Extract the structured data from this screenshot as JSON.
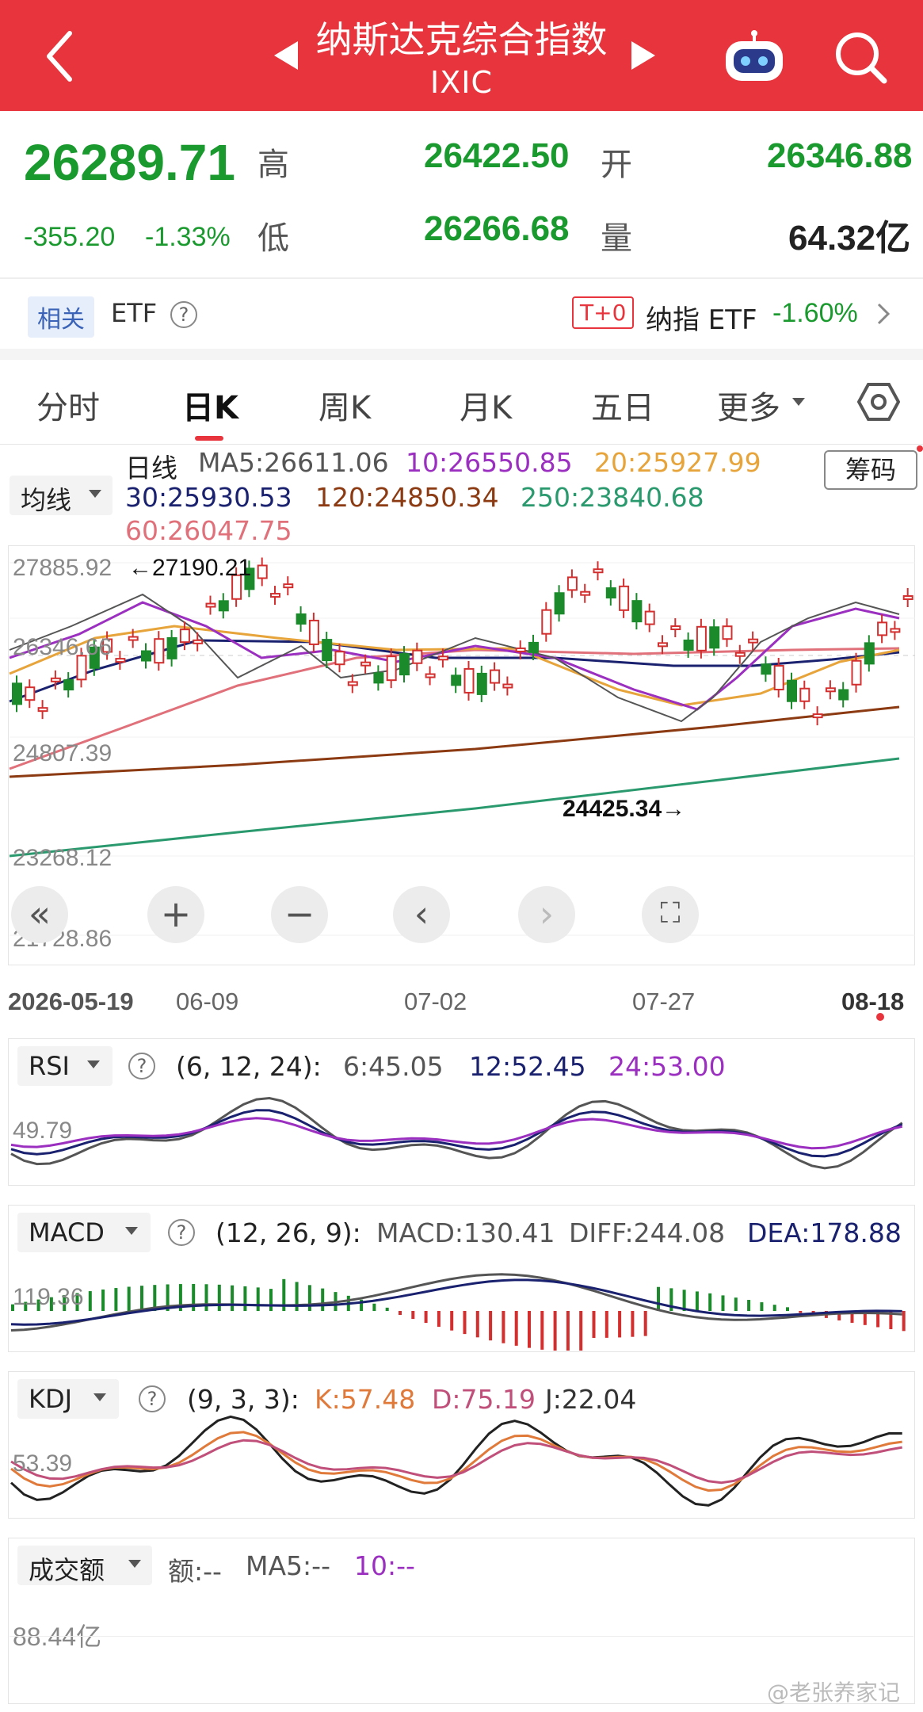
{
  "header": {
    "title": "纳斯达克综合指数",
    "symbol": "IXIC",
    "back_icon": "chevron-left-icon",
    "prev_icon": "triangle-left-icon",
    "next_icon": "triangle-right-icon",
    "robot_icon": "robot-icon",
    "search_icon": "search-icon",
    "bg_color": "#e8343c"
  },
  "quote": {
    "price": "26289.71",
    "change": "-355.20",
    "change_pct": "-1.33%",
    "high_label": "高",
    "high": "26422.50",
    "open_label": "开",
    "open": "26346.88",
    "low_label": "低",
    "low": "26266.68",
    "volume_label": "量",
    "volume": "64.32亿"
  },
  "related": {
    "tag": "相关",
    "etf_label": "ETF",
    "t0_badge": "T+0",
    "etf_name": "纳指 ETF",
    "etf_change": "-1.60%"
  },
  "tabs": [
    "分时",
    "日K",
    "周K",
    "月K",
    "五日",
    "更多"
  ],
  "active_tab": "日K",
  "settings_icon": "hexagon-settings-icon",
  "ma_legend": {
    "selector": "均线",
    "period": "日线",
    "ma5": "MA5:26611.06",
    "ma10": "10:26550.85",
    "ma20": "20:25927.99",
    "ma30": "30:25930.53",
    "ma120": "120:24850.34",
    "ma250": "250:23840.68",
    "ma60": "60:26047.75",
    "chip_button": "筹码",
    "colors": {
      "ma5": "#555555",
      "ma10": "#9b2fc0",
      "ma20": "#e6a43a",
      "ma30": "#1a2270",
      "ma120": "#8b3a12",
      "ma250": "#2a9a6e",
      "ma60": "#e0707a"
    }
  },
  "kline": {
    "y_ticks": [
      "27885.92",
      "26346.66",
      "24807.39",
      "23268.12",
      "21728.86"
    ],
    "high_annotation": "←27190.21",
    "low_annotation": "24425.34→",
    "dates": [
      "2026-05-19",
      "06-09",
      "07-02",
      "07-27",
      "08-18"
    ],
    "controls": [
      "«",
      "+",
      "−",
      "‹",
      "›",
      "⛶"
    ]
  },
  "rsi": {
    "selector": "RSI",
    "params": "(6, 12, 24):",
    "v6": "6:45.05",
    "v12": "12:52.45",
    "v24": "24:53.00",
    "tick": "49.79"
  },
  "macd": {
    "selector": "MACD",
    "params": "(12, 26, 9):",
    "macd": "MACD:130.41",
    "diff": "DIFF:244.08",
    "dea": "DEA:178.88",
    "tick": "119.36"
  },
  "kdj": {
    "selector": "KDJ",
    "params": "(9, 3, 3):",
    "k": "K:57.48",
    "d": "D:75.19",
    "j": "J:22.04",
    "tick": "53.39"
  },
  "turnover": {
    "selector": "成交额",
    "amount": "额:--",
    "ma5": "MA5:--",
    "ma10": "10:--",
    "tick": "88.44亿"
  },
  "watermark": "@老张养家记"
}
